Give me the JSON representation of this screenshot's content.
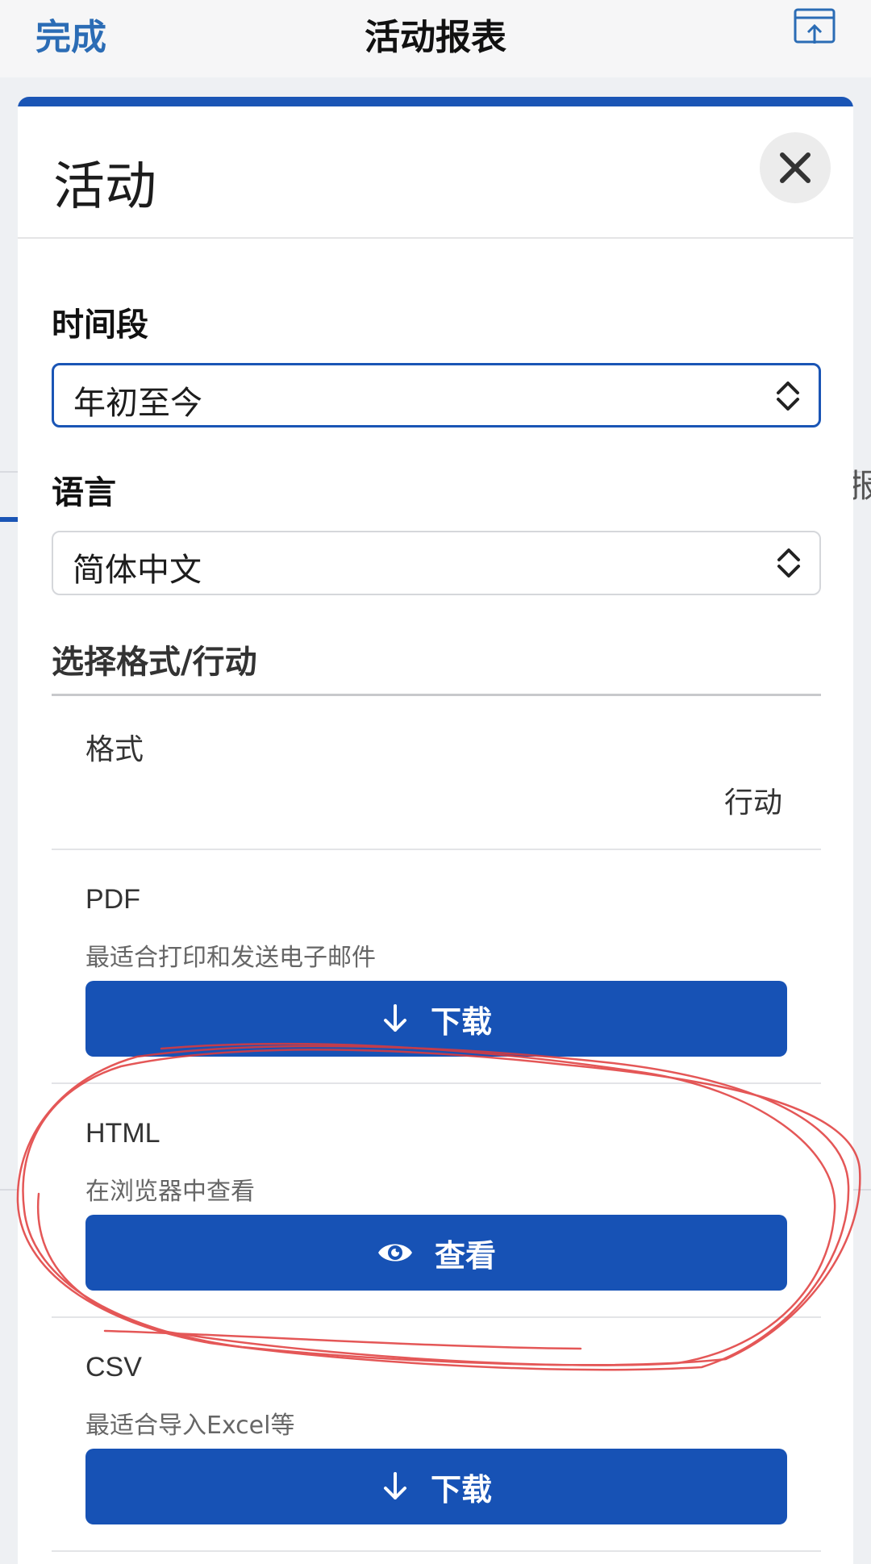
{
  "topbar": {
    "done_label": "完成",
    "title": "活动报表"
  },
  "background": {
    "peek_text": "报"
  },
  "sheet": {
    "title": "活动",
    "accent_color": "#1a55b5"
  },
  "period": {
    "label": "时间段",
    "value": "年初至今"
  },
  "language": {
    "label": "语言",
    "value": "简体中文"
  },
  "formats": {
    "heading": "选择格式/行动",
    "col_format": "格式",
    "col_action": "行动",
    "items": [
      {
        "name": "PDF",
        "description": "最适合打印和发送电子邮件",
        "action_label": "下载",
        "action_icon": "download-arrow-icon"
      },
      {
        "name": "HTML",
        "description": "在浏览器中查看",
        "action_label": "查看",
        "action_icon": "eye-icon"
      },
      {
        "name": "CSV",
        "description": "最适合导入Excel等",
        "action_label": "下载",
        "action_icon": "download-arrow-icon"
      }
    ]
  },
  "annotation": {
    "color": "#e03a3a"
  }
}
